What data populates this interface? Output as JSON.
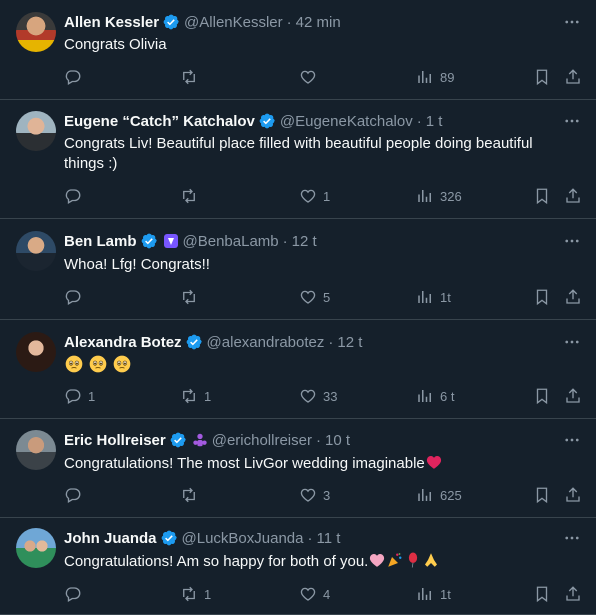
{
  "colors": {
    "background": "#15202b",
    "divider": "#38444d",
    "text": "#f7f9f9",
    "muted": "#8b98a5",
    "verified": "#1d9bf0",
    "heart_red": "#f91880"
  },
  "tweets": [
    {
      "name": "Allen Kessler",
      "handle": "@AllenKessler",
      "time": "42 min",
      "text": "Congrats Olivia",
      "replies": "",
      "retweets": "",
      "likes": "",
      "views": "89",
      "affiliate": ""
    },
    {
      "name": "Eugene “Catch” Katchalov",
      "handle": "@EugeneKatchalov",
      "time": "1 t",
      "text": "Congrats Liv! Beautiful place filled with beautiful people doing beautiful things :)",
      "replies": "",
      "retweets": "",
      "likes": "1",
      "views": "326",
      "affiliate": ""
    },
    {
      "name": "Ben Lamb",
      "handle": "@BenbaLamb",
      "time": "12 t",
      "text": "Whoa! Lfg! Congrats!!",
      "replies": "",
      "retweets": "",
      "likes": "5",
      "views": "1t",
      "affiliate": "purple-badge-icon"
    },
    {
      "name": "Alexandra Botez",
      "handle": "@alexandrabotez",
      "time": "12 t",
      "text": "🥹🥹🥹",
      "replies": "1",
      "retweets": "1",
      "likes": "33",
      "views": "6 t",
      "affiliate": ""
    },
    {
      "name": "Eric Hollreiser",
      "handle": "@erichollreiser",
      "time": "10 t",
      "text": "Congratulations! The most LivGor wedding imaginable",
      "text_emoji": "red-heart-icon",
      "replies": "",
      "retweets": "",
      "likes": "3",
      "views": "625",
      "affiliate": "people-icon"
    },
    {
      "name": "John Juanda",
      "handle": "@LuckBoxJuanda",
      "time": "11 t",
      "text": "Congratulations! Am so happy for both of you.",
      "text_emoji": "pink-heart confetti balloon pray-hands",
      "replies": "",
      "retweets": "1",
      "likes": "4",
      "views": "1t",
      "affiliate": ""
    }
  ],
  "separator": "·"
}
